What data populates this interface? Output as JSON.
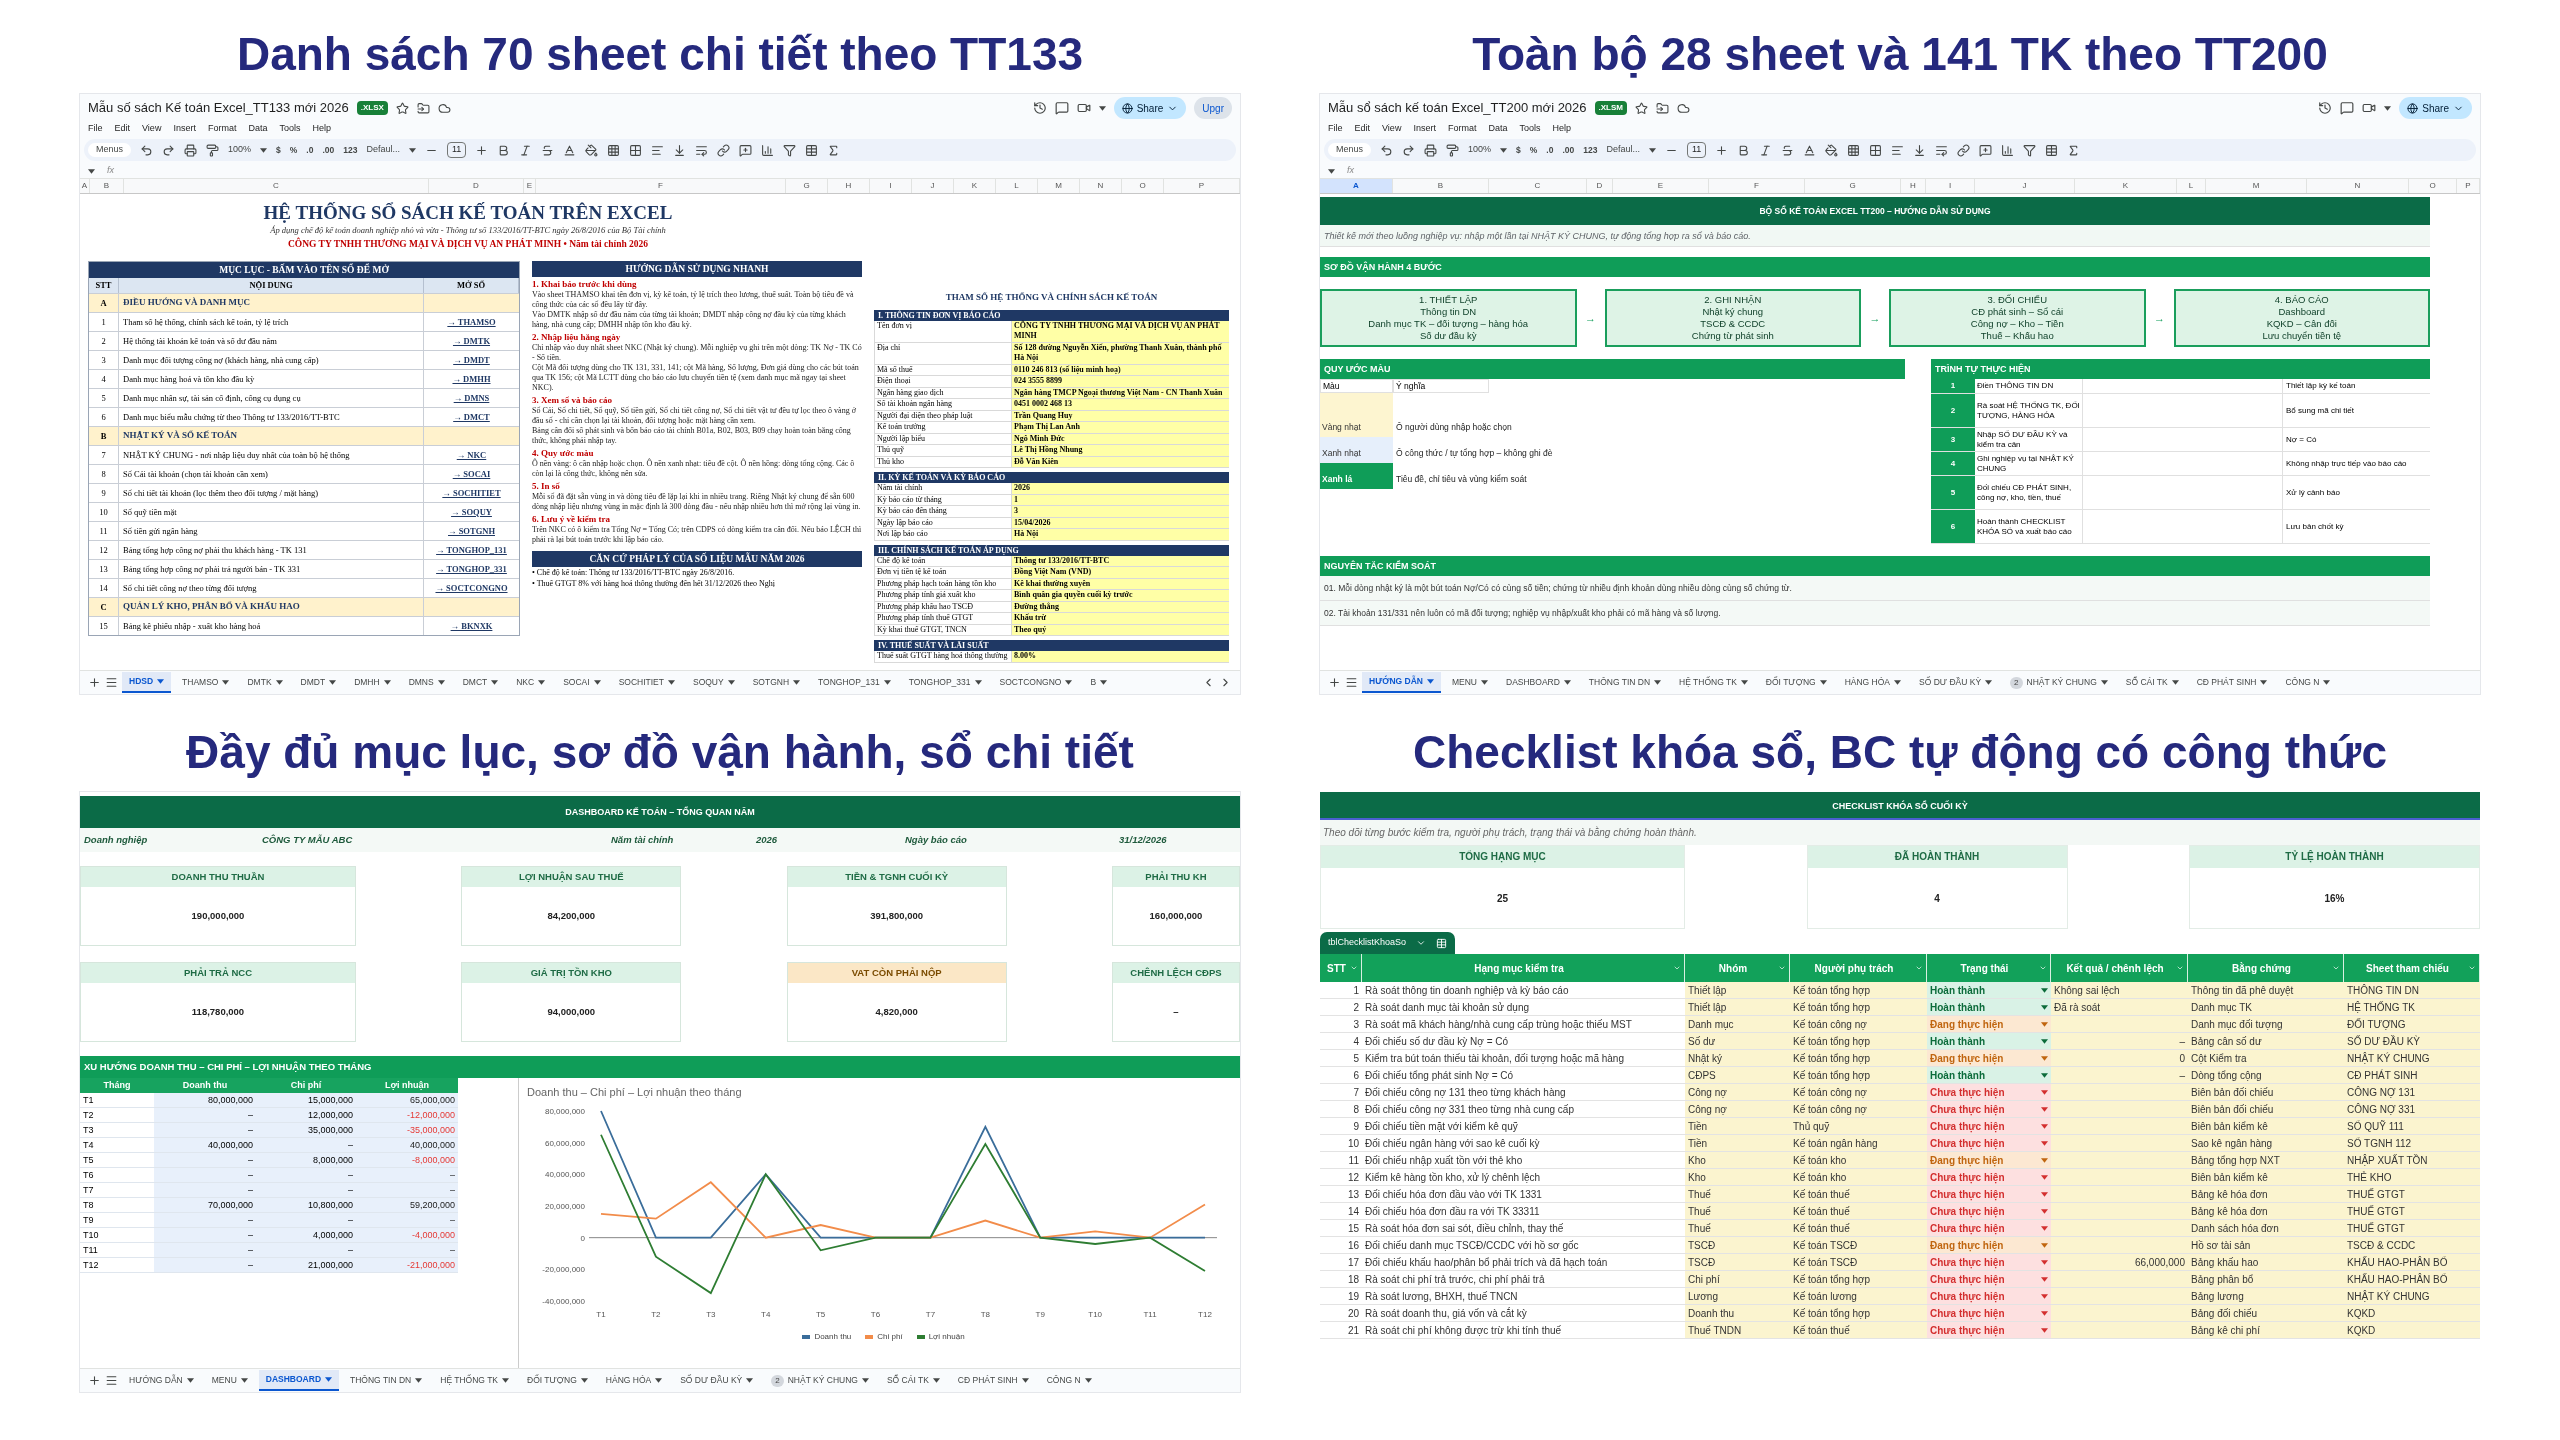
{
  "toc_sheet": {
    "heading": "Danh sách 70 sheet chi tiết theo TT133",
    "file_title": "Mẫu số sách Kế toán Excel_TT133 mới 2026",
    "badge": ".XLSX",
    "menus": [
      "File",
      "Edit",
      "View",
      "Insert",
      "Format",
      "Data",
      "Tools",
      "Help"
    ],
    "toolbar": {
      "menus": "Menus",
      "zoom": "100%",
      "formats": [
        "$",
        "%",
        ".0",
        ".00",
        "123"
      ],
      "font": "Defaul...",
      "size": "11"
    },
    "share": "Share",
    "upgrade": "Upgr",
    "formula_icon": "fx",
    "columns": [
      {
        "label": "A",
        "selected": false
      },
      {
        "label": "B",
        "selected": false
      },
      {
        "label": "C",
        "selected": false
      },
      {
        "label": "D",
        "selected": false
      },
      {
        "label": "E",
        "selected": false
      },
      {
        "label": "F",
        "selected": false
      },
      {
        "label": "G",
        "selected": false
      },
      {
        "label": "H",
        "selected": false
      },
      {
        "label": "I",
        "selected": false
      },
      {
        "label": "J",
        "selected": false
      },
      {
        "label": "K",
        "selected": false
      },
      {
        "label": "L",
        "selected": false
      },
      {
        "label": "M",
        "selected": false
      },
      {
        "label": "N",
        "selected": false
      },
      {
        "label": "O",
        "selected": false
      },
      {
        "label": "P",
        "selected": false
      }
    ],
    "title": "HỆ THỐNG SỔ SÁCH KẾ TOÁN TRÊN EXCEL",
    "subtitle": "Áp dụng chế độ kế toán doanh nghiệp nhỏ và vừa - Thông tư số 133/2016/TT-BTC ngày 26/8/2016 của Bộ Tài chính",
    "company": "CÔNG TY TNHH THƯƠNG MẠI VÀ DỊCH VỤ AN PHÁT MINH  •  Năm tài chính 2026",
    "toc": {
      "title": "MỤC LỤC - BẤM VÀO TÊN SỔ ĐỂ MỞ",
      "headers": [
        "STT",
        "NỘI DUNG",
        "MỞ SỔ"
      ],
      "rows": [
        {
          "kind": "section",
          "no": "A",
          "text": "ĐIỀU HƯỚNG VÀ DANH MỤC"
        },
        {
          "kind": "item",
          "no": "1",
          "text": "Tham số hệ thống, chính sách kế toán, tỷ lệ trích",
          "link": "→ THAMSO"
        },
        {
          "kind": "item",
          "no": "2",
          "text": "Hệ thống tài khoản kế toán và số dư đầu năm",
          "link": "→ DMTK"
        },
        {
          "kind": "item",
          "no": "3",
          "text": "Danh mục đối tượng công nợ (khách hàng, nhà cung cấp)",
          "link": "→ DMDT"
        },
        {
          "kind": "item",
          "no": "4",
          "text": "Danh mục hàng hoá và tồn kho đầu kỳ",
          "link": "→ DMHH"
        },
        {
          "kind": "item",
          "no": "5",
          "text": "Danh mục nhân sự, tài sản cố định, công cụ dụng cụ",
          "link": "→ DMNS"
        },
        {
          "kind": "item",
          "no": "6",
          "text": "Danh mục biểu mẫu chứng từ theo Thông tư 133/2016/TT-BTC",
          "link": "→ DMCT"
        },
        {
          "kind": "section",
          "no": "B",
          "text": "NHẬT KÝ VÀ SỔ KẾ TOÁN"
        },
        {
          "kind": "item",
          "no": "7",
          "text": "NHẬT KÝ CHUNG - nơi nhập liệu duy nhất của toàn bộ hệ thống",
          "link": "→ NKC"
        },
        {
          "kind": "item",
          "no": "8",
          "text": "Sổ Cái tài khoản (chọn tài khoản cần xem)",
          "link": "→ SOCAI"
        },
        {
          "kind": "item",
          "no": "9",
          "text": "Sổ chi tiết tài khoản (lọc thêm theo đối tượng / mặt hàng)",
          "link": "→ SOCHITIET"
        },
        {
          "kind": "item",
          "no": "10",
          "text": "Sổ quỹ tiền mặt",
          "link": "→ SOQUY"
        },
        {
          "kind": "item",
          "no": "11",
          "text": "Sổ tiền gửi ngân hàng",
          "link": "→ SOTGNH"
        },
        {
          "kind": "item",
          "no": "12",
          "text": "Bảng tổng hợp công nợ phải thu khách hàng - TK 131",
          "link": "→ TONGHOP_131"
        },
        {
          "kind": "item",
          "no": "13",
          "text": "Bảng tổng hợp công nợ phải trả người bán - TK 331",
          "link": "→ TONGHOP_331"
        },
        {
          "kind": "item",
          "no": "14",
          "text": "Sổ chi tiết công nợ theo từng đối tượng",
          "link": "→ SOCTCONGNO"
        },
        {
          "kind": "section",
          "no": "C",
          "text": "QUẢN LÝ KHO, PHÂN BỔ VÀ KHẤU HAO"
        },
        {
          "kind": "item",
          "no": "15",
          "text": "Bảng kê phiếu nhập - xuất kho hàng hoá",
          "link": "→ BKNXK"
        }
      ]
    },
    "guide": {
      "title": "HƯỚNG DẪN SỬ DỤNG NHANH",
      "steps": [
        {
          "heading": "1. Khai báo trước khi dùng",
          "paragraphs": [
            "Vào sheet THAMSO khai tên đơn vị, kỳ kế toán, tỷ lệ trích theo lương, thuế suất. Toàn bộ tiêu đề và công thức của các sổ đều lấy từ đây.",
            "Vào DMTK nhập số dư đầu năm của từng tài khoản; DMDT nhập công nợ đầu kỳ của từng khách hàng, nhà cung cấp; DMHH nhập tồn kho đầu kỳ."
          ]
        },
        {
          "heading": "2. Nhập liệu hằng ngày",
          "paragraphs": [
            "Chỉ nhập vào duy nhất sheet NKC (Nhật ký chung). Mỗi nghiệp vụ ghi trên một dòng: TK Nợ - TK Có - Số tiền.",
            "Cột Mã đối tượng dùng cho TK 131, 331, 141; cột Mã hàng, Số lượng, Đơn giá dùng cho các bút toán qua TK 156; cột Mã LCTT dùng cho báo cáo lưu chuyển tiền tệ (xem danh mục mã ngay tại sheet NKC)."
          ]
        },
        {
          "heading": "3. Xem sổ và báo cáo",
          "paragraphs": [
            "Sổ Cái, Sổ chi tiết, Sổ quỹ, Sổ tiền gửi, Sổ chi tiết công nợ, Sổ chi tiết vật tư đều tự lọc theo ô vàng ở đầu sổ - chỉ cần chọn lại tài khoản, đối tượng hoặc mặt hàng cần xem.",
            "Bảng cân đối số phát sinh và bốn báo cáo tài chính B01a, B02, B03, B09 chạy hoàn toàn bằng công thức, không phải nhập tay."
          ]
        },
        {
          "heading": "4. Quy ước màu",
          "paragraphs": [
            "Ô nền vàng: ô cần nhập hoặc chọn. Ô nền xanh nhạt: tiêu đề cột. Ô nền hồng: dòng tổng cộng. Các ô còn lại là công thức, không nên sửa."
          ]
        },
        {
          "heading": "5. In sổ",
          "paragraphs": [
            "Mỗi sổ đã đặt sẵn vùng in và dòng tiêu đề lặp lại khi in nhiều trang. Riêng Nhật ký chung để sẵn 600 dòng nhập liệu nhưng vùng in mặc định là 300 dòng đầu - nếu nhập nhiều hơn thì mở rộng lại vùng in."
          ]
        },
        {
          "heading": "6. Lưu ý về kiểm tra",
          "paragraphs": [
            "Trên NKC có ô kiểm tra Tổng Nợ = Tổng Có; trên CDPS có dòng kiểm tra cân đối. Nếu báo LỆCH thì phải rà lại bút toán trước khi lập báo cáo."
          ]
        }
      ]
    },
    "legal": {
      "title": "CĂN CỨ PHÁP LÝ CỦA SỐ LIỆU MẪU NĂM 2026",
      "bullets": [
        "• Chế độ kế toán: Thông tư 133/2016/TT-BTC ngày 26/8/2016.",
        "• Thuế GTGT 8% với hàng hoá thông thường đến hết 31/12/2026 theo Nghị"
      ]
    },
    "params": {
      "title": "THAM SỐ HỆ THỐNG VÀ CHÍNH SÁCH KẾ TOÁN",
      "groups": [
        {
          "title": "I. THÔNG TIN ĐƠN VỊ BÁO CÁO",
          "rows": [
            {
              "label": "Tên đơn vị",
              "value": "CÔNG TY TNHH THƯƠNG MẠI VÀ DỊCH VỤ AN PHÁT MINH"
            },
            {
              "label": "Địa chỉ",
              "value": "Số 128 đường Nguyễn Xiển, phường Thanh Xuân, thành phố Hà Nội"
            },
            {
              "label": "Mã số thuế",
              "value": "0110 246 813 (số liệu minh hoạ)"
            },
            {
              "label": "Điện thoại",
              "value": "024 3555 8899"
            },
            {
              "label": "Ngân hàng giao dịch",
              "value": "Ngân hàng TMCP Ngoại thương Việt Nam - CN Thanh Xuân"
            },
            {
              "label": "Số tài khoản ngân hàng",
              "value": "0451 0002 468 13"
            },
            {
              "label": "Người đại diện theo pháp luật",
              "value": "Trần Quang Huy"
            },
            {
              "label": "Kế toán trưởng",
              "value": "Phạm Thị Lan Anh"
            },
            {
              "label": "Người lập biểu",
              "value": "Ngô Minh Đức"
            },
            {
              "label": "Thủ quỹ",
              "value": "Lê Thị Hồng Nhung"
            },
            {
              "label": "Thủ kho",
              "value": "Đỗ Văn Kiên"
            }
          ]
        },
        {
          "title": "II. KỲ KẾ TOÁN VÀ KỲ BÁO CÁO",
          "rows": [
            {
              "label": "Năm tài chính",
              "value": "2026"
            },
            {
              "label": "Kỳ báo cáo từ tháng",
              "value": "1"
            },
            {
              "label": "Kỳ báo cáo đến tháng",
              "value": "3"
            },
            {
              "label": "Ngày lập báo cáo",
              "value": "15/04/2026"
            },
            {
              "label": "Nơi lập báo cáo",
              "value": "Hà Nội"
            }
          ]
        },
        {
          "title": "III. CHÍNH SÁCH KẾ TOÁN ÁP DỤNG",
          "rows": [
            {
              "label": "Chế độ kế toán",
              "value": "Thông tư 133/2016/TT-BTC"
            },
            {
              "label": "Đơn vị tiền tệ kế toán",
              "value": "Đồng Việt Nam (VND)"
            },
            {
              "label": "Phương pháp hạch toán hàng tồn kho",
              "value": "Kê khai thường xuyên"
            },
            {
              "label": "Phương pháp tính giá xuất kho",
              "value": "Bình quân gia quyền cuối kỳ trước"
            },
            {
              "label": "Phương pháp khấu hao TSCĐ",
              "value": "Đường thẳng"
            },
            {
              "label": "Phương pháp tính thuế GTGT",
              "value": "Khấu trừ"
            },
            {
              "label": "Kỳ khai thuế GTGT, TNCN",
              "value": "Theo quý"
            }
          ]
        },
        {
          "title": "IV. THUẾ SUẤT VÀ LÃI SUẤT",
          "rows": [
            {
              "label": "Thuế suất GTGT hàng hoá thông thường",
              "value": "8.00%"
            }
          ]
        }
      ]
    },
    "tabs": [
      {
        "label": "HDSD",
        "selected": true
      },
      {
        "label": "THAMSO",
        "selected": false
      },
      {
        "label": "DMTK",
        "selected": false
      },
      {
        "label": "DMDT",
        "selected": false
      },
      {
        "label": "DMHH",
        "selected": false
      },
      {
        "label": "DMNS",
        "selected": false
      },
      {
        "label": "DMCT",
        "selected": false
      },
      {
        "label": "NKC",
        "selected": false
      },
      {
        "label": "SOCAI",
        "selected": false
      },
      {
        "label": "SOCHITIET",
        "selected": false
      },
      {
        "label": "SOQUY",
        "selected": false
      },
      {
        "label": "SOTGNH",
        "selected": false
      },
      {
        "label": "TONGHOP_131",
        "selected": false
      },
      {
        "label": "TONGHOP_331",
        "selected": false
      },
      {
        "label": "SOCTCONGNO",
        "selected": false
      },
      {
        "label": "B",
        "selected": false
      }
    ]
  },
  "guide_sheet": {
    "heading": "Toàn bộ 28 sheet và 141 TK theo TT200",
    "file_title": "Mẫu sổ sách kế toán Excel_TT200 mới 2026",
    "badge": ".XLSM",
    "menus": [
      "File",
      "Edit",
      "View",
      "Insert",
      "Format",
      "Data",
      "Tools",
      "Help"
    ],
    "toolbar": {
      "menus": "Menus",
      "zoom": "100%",
      "formats": [
        "$",
        "%",
        ".0",
        ".00",
        "123"
      ],
      "font": "Defaul...",
      "size": "11"
    },
    "share": "Share",
    "formula_icon": "fx",
    "columns": [
      {
        "label": "A",
        "selected": true
      },
      {
        "label": "B",
        "selected": false
      },
      {
        "label": "C",
        "selected": false
      },
      {
        "label": "D",
        "selected": false
      },
      {
        "label": "E",
        "selected": false
      },
      {
        "label": "F",
        "selected": false
      },
      {
        "label": "G",
        "selected": false
      },
      {
        "label": "H",
        "selected": false
      },
      {
        "label": "I",
        "selected": false
      },
      {
        "label": "J",
        "selected": false
      },
      {
        "label": "K",
        "selected": false
      },
      {
        "label": "L",
        "selected": false
      },
      {
        "label": "M",
        "selected": false
      },
      {
        "label": "N",
        "selected": false
      },
      {
        "label": "O",
        "selected": false
      },
      {
        "label": "P",
        "selected": false
      }
    ],
    "banner": "BỘ SỔ KẾ TOÁN EXCEL TT200 – HƯỚNG DẪN SỬ DỤNG",
    "intro": "Thiết kế mới theo luồng nghiệp vụ: nhập một lần tại NHẬT KÝ CHUNG, tự động tổng hợp ra sổ và báo cáo.",
    "flow": {
      "title": "SƠ ĐỒ VẬN HÀNH 4 BƯỚC",
      "steps": [
        {
          "lines": [
            "1. THIẾT LẬP",
            "Thông tin DN",
            "Danh mục TK – đối tượng – hàng hóa",
            "Số dư đầu kỳ"
          ]
        },
        {
          "connector": "→",
          "lines": [
            "2. GHI NHẬN",
            "Nhật ký chung",
            "TSCĐ & CCDC",
            "Chứng từ phát sinh"
          ]
        },
        {
          "connector": "→",
          "lines": [
            "3. ĐỐI CHIẾU",
            "CĐ phát sinh – Sổ cái",
            "Công nợ – Kho – Tiền",
            "Thuế – Khấu hao"
          ]
        },
        {
          "connector": "→",
          "lines": [
            "4. BÁO CÁO",
            "Dashboard",
            "KQKD – Cân đối",
            "Lưu chuyển tiền tệ"
          ]
        }
      ]
    },
    "legend": {
      "title": "QUY ƯỚC MÀU",
      "headers": [
        "Màu",
        "Ý nghĩa"
      ],
      "items": [
        {
          "name": "Vàng nhạt",
          "meaning": "Ô người dùng nhập hoặc chọn",
          "color": "#fdf5d0",
          "kind": "light"
        },
        {
          "name": "Xanh nhạt",
          "meaning": "Ô công thức / tự tổng hợp – không ghi đè",
          "color": "#e6effb",
          "kind": "light"
        },
        {
          "name": "Xanh lá",
          "meaning": "Tiêu đề, chỉ tiêu và vùng kiểm soát",
          "color": "#0f9d58",
          "kind": "dark"
        }
      ]
    },
    "sequence": {
      "title": "TRÌNH TỰ THỰC HIỆN",
      "rows": [
        {
          "no": "1",
          "task": "Điền THÔNG TIN DN",
          "note": "Thiết lập kỳ kế toán"
        },
        {
          "no": "2",
          "task": "Rà soát HỆ THỐNG TK, ĐỐI TƯỢNG, HÀNG HÓA",
          "note": "Bổ sung mã chi tiết"
        },
        {
          "no": "3",
          "task": "Nhập SỐ DƯ ĐẦU KỲ và kiểm tra cân",
          "note": "Nợ = Có"
        },
        {
          "no": "4",
          "task": "Ghi nghiệp vụ tại NHẬT KÝ CHUNG",
          "note": "Không nhập trực tiếp vào báo cáo"
        },
        {
          "no": "5",
          "task": "Đối chiếu CĐ PHÁT SINH, công nợ, kho, tiền, thuế",
          "note": "Xử lý cảnh báo"
        },
        {
          "no": "6",
          "task": "Hoàn thành CHECKLIST KHÓA SỔ và xuất báo cáo",
          "note": "Lưu bản chốt kỳ"
        }
      ]
    },
    "controls": {
      "title": "NGUYÊN TẮC KIỂM SOÁT",
      "rules": [
        "01. Mỗi dòng nhật ký là một bút toán Nợ/Có có cùng số tiền; chứng từ nhiều định khoản dùng nhiều dòng cùng số chứng từ.",
        "02. Tài khoản 131/331 nên luôn có mã đối tượng; nghiệp vụ nhập/xuất kho phải có mã hàng và số lượng."
      ]
    },
    "tabs": [
      {
        "label": "HƯỚNG DẪN",
        "selected": true
      },
      {
        "label": "MENU",
        "selected": false
      },
      {
        "label": "DASHBOARD",
        "selected": false
      },
      {
        "label": "THÔNG TIN DN",
        "selected": false
      },
      {
        "label": "HỆ THỐNG TK",
        "selected": false
      },
      {
        "label": "ĐỐI TƯỢNG",
        "selected": false
      },
      {
        "label": "HÀNG HÓA",
        "selected": false
      },
      {
        "label": "SỐ DƯ ĐẦU KỲ",
        "selected": false
      },
      {
        "label": "NHẬT KÝ CHUNG",
        "selected": false,
        "badge": "2"
      },
      {
        "label": "SỔ CÁI TK",
        "selected": false
      },
      {
        "label": "CĐ PHÁT SINH",
        "selected": false
      },
      {
        "label": "CÔNG N",
        "selected": false
      }
    ]
  },
  "dashboard_sheet": {
    "heading": "Đầy đủ mục lục, sơ đồ vận hành, sổ chi tiết",
    "banner": "DASHBOARD KẾ TOÁN – TỔNG QUAN NĂM",
    "info": [
      {
        "label": "Doanh nghiệp",
        "value": "CÔNG TY MẪU ABC"
      },
      {
        "label": "Năm tài chính",
        "value": "2026"
      },
      {
        "label": "Ngày báo cáo",
        "value": "31/12/2026"
      }
    ],
    "kpis": [
      {
        "label": "DOANH THU THUẦN",
        "value": "190,000,000",
        "kind": "normal"
      },
      {
        "label": "LỢI NHUẬN SAU THUẾ",
        "value": "84,200,000",
        "kind": "normal"
      },
      {
        "label": "TIỀN & TGNH CUỐI KỲ",
        "value": "391,800,000",
        "kind": "normal"
      },
      {
        "label": "PHẢI THU KH",
        "value": "160,000,000",
        "kind": "normal"
      },
      {
        "label": "PHẢI TRẢ NCC",
        "value": "118,780,000",
        "kind": "normal"
      },
      {
        "label": "GIÁ TRỊ TỒN KHO",
        "value": "94,000,000",
        "kind": "normal"
      },
      {
        "label": "VAT CÒN PHẢI NỘP",
        "value": "4,820,000",
        "kind": "warning"
      },
      {
        "label": "CHÊNH LỆCH CĐPS",
        "value": "–",
        "kind": "normal"
      }
    ],
    "trend": {
      "title": "XU HƯỚNG DOANH THU – CHI PHÍ – LỢI NHUẬN THEO THÁNG",
      "headers": [
        "Tháng",
        "Doanh thu",
        "Chi phí",
        "Lợi nhuận"
      ],
      "rows": [
        {
          "month": "T1",
          "revenue": "80,000,000",
          "cost": "15,000,000",
          "profit": "65,000,000",
          "loss": false
        },
        {
          "month": "T2",
          "revenue": "–",
          "cost": "12,000,000",
          "profit": "-12,000,000",
          "loss": true
        },
        {
          "month": "T3",
          "revenue": "–",
          "cost": "35,000,000",
          "profit": "-35,000,000",
          "loss": true
        },
        {
          "month": "T4",
          "revenue": "40,000,000",
          "cost": "–",
          "profit": "40,000,000",
          "loss": false
        },
        {
          "month": "T5",
          "revenue": "–",
          "cost": "8,000,000",
          "profit": "-8,000,000",
          "loss": true
        },
        {
          "month": "T6",
          "revenue": "–",
          "cost": "–",
          "profit": "–",
          "loss": false
        },
        {
          "month": "T7",
          "revenue": "–",
          "cost": "–",
          "profit": "–",
          "loss": false
        },
        {
          "month": "T8",
          "revenue": "70,000,000",
          "cost": "10,800,000",
          "profit": "59,200,000",
          "loss": false
        },
        {
          "month": "T9",
          "revenue": "–",
          "cost": "–",
          "profit": "–",
          "loss": false
        },
        {
          "month": "T10",
          "revenue": "–",
          "cost": "4,000,000",
          "profit": "-4,000,000",
          "loss": true
        },
        {
          "month": "T11",
          "revenue": "–",
          "cost": "–",
          "profit": "–",
          "loss": false
        },
        {
          "month": "T12",
          "revenue": "–",
          "cost": "21,000,000",
          "profit": "-21,000,000",
          "loss": true
        }
      ],
      "chart_data": {
        "type": "line",
        "title": "Doanh thu – Chi phí – Lợi nhuận theo tháng",
        "categories": [
          "T1",
          "T2",
          "T3",
          "T4",
          "T5",
          "T6",
          "T7",
          "T8",
          "T9",
          "T10",
          "T11",
          "T12"
        ],
        "series": [
          {
            "name": "Doanh thu",
            "color": "#3a6d9a",
            "values": [
              80000000,
              0,
              0,
              40000000,
              0,
              0,
              0,
              70000000,
              0,
              0,
              0,
              0
            ]
          },
          {
            "name": "Chi phí",
            "color": "#f28c4a",
            "values": [
              15000000,
              12000000,
              35000000,
              0,
              8000000,
              0,
              0,
              10800000,
              0,
              4000000,
              0,
              21000000
            ]
          },
          {
            "name": "Lợi nhuận",
            "color": "#2e7d32",
            "values": [
              65000000,
              -12000000,
              -35000000,
              40000000,
              -8000000,
              0,
              0,
              59200000,
              0,
              -4000000,
              0,
              -21000000
            ]
          }
        ],
        "ylim": [
          -40000000,
          80000000
        ],
        "yticks": [
          {
            "value": 80000000,
            "label": "80,000,000"
          },
          {
            "value": 60000000,
            "label": "60,000,000"
          },
          {
            "value": 40000000,
            "label": "40,000,000"
          },
          {
            "value": 20000000,
            "label": "20,000,000"
          },
          {
            "value": 0,
            "label": "0"
          },
          {
            "value": -20000000,
            "label": "-20,000,000"
          },
          {
            "value": -40000000,
            "label": "-40,000,000"
          }
        ]
      }
    },
    "tabs": [
      {
        "label": "HƯỚNG DẪN",
        "selected": false
      },
      {
        "label": "MENU",
        "selected": false
      },
      {
        "label": "DASHBOARD",
        "selected": true
      },
      {
        "label": "THÔNG TIN DN",
        "selected": false
      },
      {
        "label": "HỆ THỐNG TK",
        "selected": false
      },
      {
        "label": "ĐỐI TƯỢNG",
        "selected": false
      },
      {
        "label": "HÀNG HÓA",
        "selected": false
      },
      {
        "label": "SỐ DƯ ĐẦU KỲ",
        "selected": false
      },
      {
        "label": "NHẬT KÝ CHUNG",
        "selected": false,
        "badge": "2"
      },
      {
        "label": "SỔ CÁI TK",
        "selected": false
      },
      {
        "label": "CĐ PHÁT SINH",
        "selected": false
      },
      {
        "label": "CÔNG N",
        "selected": false
      }
    ]
  },
  "checklist_sheet": {
    "heading": "Checklist khóa sổ, BC tự động có công thức",
    "banner": "CHECKLIST KHÓA SỔ CUỐI KỲ",
    "intro": "Theo dõi từng bước kiểm tra, người phụ trách, trạng thái và bằng chứng hoàn thành.",
    "kpis": [
      {
        "label": "TỔNG HẠNG MỤC",
        "value": "25"
      },
      {
        "label": "ĐÃ HOÀN THÀNH",
        "value": "4"
      },
      {
        "label": "TỶ LỆ HOÀN THÀNH",
        "value": "16%"
      }
    ],
    "table_name": "tblChecklistKhoaSo",
    "headers": [
      "STT",
      "Hạng mục kiểm tra",
      "Nhóm",
      "Người phụ trách",
      "Trạng thái",
      "Kết quả / chênh lệch",
      "Bằng chứng",
      "Sheet tham chiếu"
    ],
    "rows": [
      {
        "no": "1",
        "item": "Rà soát thông tin doanh nghiệp và kỳ báo cáo",
        "group": "Thiết lập",
        "owner": "Kế toán tổng hợp",
        "status": "Hoàn thành",
        "kind": "done",
        "result": "Không sai lệch",
        "evidence": "Thông tin đã phê duyệt",
        "sheet": "THÔNG TIN DN"
      },
      {
        "no": "2",
        "item": "Rà soát danh mục tài khoản sử dụng",
        "group": "Thiết lập",
        "owner": "Kế toán tổng hợp",
        "status": "Hoàn thành",
        "kind": "done",
        "result": "Đã rà soát",
        "evidence": "Danh mục TK",
        "sheet": "HỆ THỐNG TK"
      },
      {
        "no": "3",
        "item": "Rà soát mã khách hàng/nhà cung cấp trùng hoặc thiếu MST",
        "group": "Danh mục",
        "owner": "Kế toán công nợ",
        "status": "Đang thực hiện",
        "kind": "doing",
        "evidence": "Danh mục đối tượng",
        "sheet": "ĐỐI TƯỢNG"
      },
      {
        "no": "4",
        "item": "Đối chiếu số dư đầu kỳ Nợ = Có",
        "group": "Số dư",
        "owner": "Kế toán tổng hợp",
        "status": "Hoàn thành",
        "kind": "done",
        "amount": "–",
        "evidence": "Bảng cân số dư",
        "sheet": "SỐ DƯ ĐẦU KỲ"
      },
      {
        "no": "5",
        "item": "Kiểm tra bút toán thiếu tài khoản, đối tượng hoặc mã hàng",
        "group": "Nhật ký",
        "owner": "Kế toán tổng hợp",
        "status": "Đang thực hiện",
        "kind": "doing",
        "amount": "0",
        "evidence": "Cột Kiểm tra",
        "sheet": "NHẬT KÝ CHUNG"
      },
      {
        "no": "6",
        "item": "Đối chiếu tổng phát sinh Nợ = Có",
        "group": "CĐPS",
        "owner": "Kế toán tổng hợp",
        "status": "Hoàn thành",
        "kind": "done",
        "amount": "–",
        "evidence": "Dòng tổng cộng",
        "sheet": "CĐ PHÁT SINH"
      },
      {
        "no": "7",
        "item": "Đối chiếu công nợ 131 theo từng khách hàng",
        "group": "Công nợ",
        "owner": "Kế toán công nợ",
        "status": "Chưa thực hiện",
        "kind": "todo",
        "evidence": "Biên bản đối chiếu",
        "sheet": "CÔNG NỢ 131"
      },
      {
        "no": "8",
        "item": "Đối chiếu công nợ 331 theo từng nhà cung cấp",
        "group": "Công nợ",
        "owner": "Kế toán công nợ",
        "status": "Chưa thực hiện",
        "kind": "todo",
        "evidence": "Biên bản đối chiếu",
        "sheet": "CÔNG NỢ 331"
      },
      {
        "no": "9",
        "item": "Đối chiếu tiền mặt với kiểm kê quỹ",
        "group": "Tiền",
        "owner": "Thủ quỹ",
        "status": "Chưa thực hiện",
        "kind": "todo",
        "evidence": "Biên bản kiểm kê",
        "sheet": "SỔ QUỸ 111"
      },
      {
        "no": "10",
        "item": "Đối chiếu ngân hàng với sao kê cuối kỳ",
        "group": "Tiền",
        "owner": "Kế toán ngân hàng",
        "status": "Chưa thực hiện",
        "kind": "todo",
        "evidence": "Sao kê ngân hàng",
        "sheet": "SỔ TGNH 112"
      },
      {
        "no": "11",
        "item": "Đối chiếu nhập xuất tồn với thẻ kho",
        "group": "Kho",
        "owner": "Kế toán kho",
        "status": "Đang thực hiện",
        "kind": "doing",
        "evidence": "Bảng tổng hợp NXT",
        "sheet": "NHẬP XUẤT TỒN"
      },
      {
        "no": "12",
        "item": "Kiểm kê hàng tồn kho, xử lý chênh lệch",
        "group": "Kho",
        "owner": "Kế toán kho",
        "status": "Chưa thực hiện",
        "kind": "todo",
        "evidence": "Biên bản kiểm kê",
        "sheet": "THẺ KHO"
      },
      {
        "no": "13",
        "item": "Đối chiếu hóa đơn đầu vào với TK 1331",
        "group": "Thuế",
        "owner": "Kế toán thuế",
        "status": "Chưa thực hiện",
        "kind": "todo",
        "evidence": "Bảng kê hóa đơn",
        "sheet": "THUẾ GTGT"
      },
      {
        "no": "14",
        "item": "Đối chiếu hóa đơn đầu ra với TK 33311",
        "group": "Thuế",
        "owner": "Kế toán thuế",
        "status": "Chưa thực hiện",
        "kind": "todo",
        "evidence": "Bảng kê hóa đơn",
        "sheet": "THUẾ GTGT"
      },
      {
        "no": "15",
        "item": "Rà soát hóa đơn sai sót, điều chỉnh, thay thế",
        "group": "Thuế",
        "owner": "Kế toán thuế",
        "status": "Chưa thực hiện",
        "kind": "todo",
        "evidence": "Danh sách hóa đơn",
        "sheet": "THUẾ GTGT"
      },
      {
        "no": "16",
        "item": "Đối chiếu danh mục TSCĐ/CCDC với hồ sơ gốc",
        "group": "TSCĐ",
        "owner": "Kế toán TSCĐ",
        "status": "Đang thực hiện",
        "kind": "doing",
        "evidence": "Hồ sơ tài sản",
        "sheet": "TSCĐ & CCDC"
      },
      {
        "no": "17",
        "item": "Đối chiếu khấu hao/phân bổ phải trích và đã hạch toán",
        "group": "TSCĐ",
        "owner": "Kế toán TSCĐ",
        "status": "Chưa thực hiện",
        "kind": "todo",
        "amount": "66,000,000",
        "evidence": "Bảng khấu hao",
        "sheet": "KHẤU HAO-PHÂN BỔ"
      },
      {
        "no": "18",
        "item": "Rà soát chi phí trả trước, chi phí phải trả",
        "group": "Chi phí",
        "owner": "Kế toán tổng hợp",
        "status": "Chưa thực hiện",
        "kind": "todo",
        "evidence": "Bảng phân bổ",
        "sheet": "KHẤU HAO-PHÂN BỔ"
      },
      {
        "no": "19",
        "item": "Rà soát lương, BHXH, thuế TNCN",
        "group": "Lương",
        "owner": "Kế toán lương",
        "status": "Chưa thực hiện",
        "kind": "todo",
        "evidence": "Bảng lương",
        "sheet": "NHẬT KÝ CHUNG"
      },
      {
        "no": "20",
        "item": "Rà soát doanh thu, giá vốn và cắt kỳ",
        "group": "Doanh thu",
        "owner": "Kế toán tổng hợp",
        "status": "Chưa thực hiện",
        "kind": "todo",
        "evidence": "Bảng đối chiếu",
        "sheet": "KQKD"
      },
      {
        "no": "21",
        "item": "Rà soát chi phí không được trừ khi tính thuế",
        "group": "Thuế TNDN",
        "owner": "Kế toán thuế",
        "status": "Chưa thực hiện",
        "kind": "todo",
        "evidence": "Bảng kê chi phí",
        "sheet": "KQKD"
      }
    ]
  }
}
